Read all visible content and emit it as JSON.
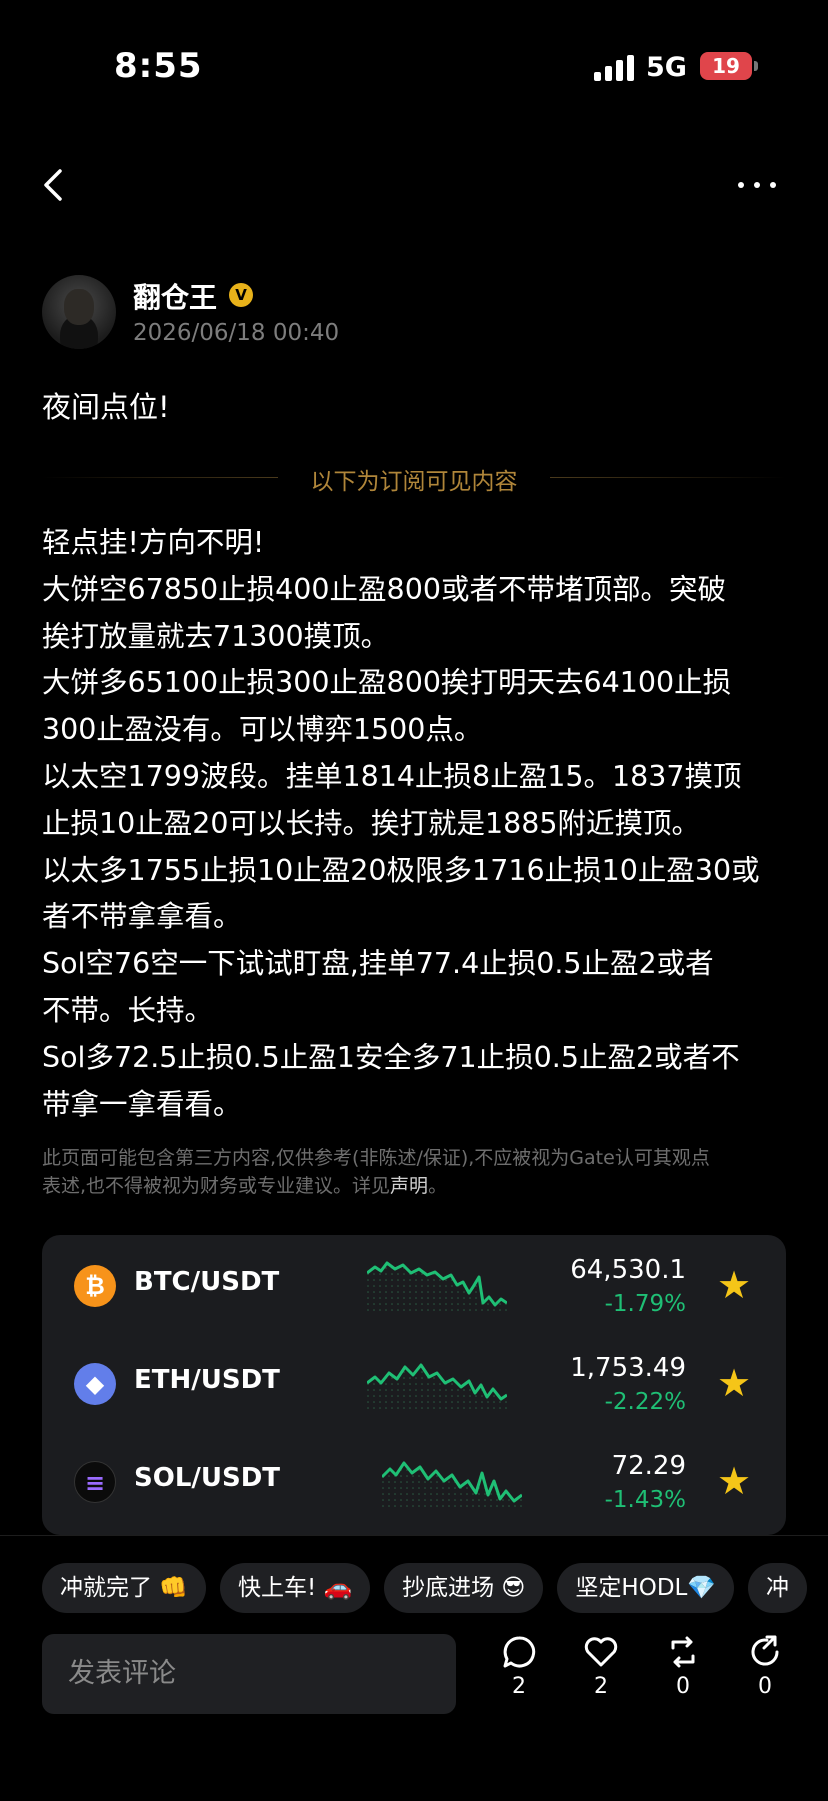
{
  "status_bar": {
    "time": "8:55",
    "network": "5G",
    "battery": "19"
  },
  "author": {
    "name": "翻仓王",
    "timestamp": "2026/06/18 00:40"
  },
  "post": {
    "intro": "夜间点位!",
    "subscribe_divider": "以下为订阅可见内容",
    "lines": [
      "轻点挂!方向不明!",
      "大饼空67850止损400止盈800或者不带堵顶部。突破",
      "挨打放量就去71300摸顶。",
      "大饼多65100止损300止盈800挨打明天去64100止损",
      "300止盈没有。可以博弈1500点。",
      "以太空1799波段。挂单1814止损8止盈15。1837摸顶",
      "止损10止盈20可以长持。挨打就是1885附近摸顶。",
      "以太多1755止损10止盈20极限多1716止损10止盈30或",
      "者不带拿拿看。",
      "Sol空76空一下试试盯盘,挂单77.4止损0.5止盈2或者",
      "不带。长持。",
      "Sol多72.5止损0.5止盈1安全多71止损0.5止盈2或者不",
      "带拿一拿看看。"
    ]
  },
  "disclaimer": {
    "line1": "此页面可能包含第三方内容,仅供参考(非陈述/保证),不应被视为Gate认可其观点",
    "line2": "表述,也不得被视为财务或专业建议。详见",
    "link": "声明",
    "end": "。"
  },
  "markets": [
    {
      "pair": "BTC/USDT",
      "price": "64,530.1",
      "change": "-1.79%",
      "icon": "bitcoin-icon",
      "glyph": "₿",
      "color": "#f7931a"
    },
    {
      "pair": "ETH/USDT",
      "price": "1,753.49",
      "change": "-2.22%",
      "icon": "ethereum-icon",
      "glyph": "◆",
      "color": "#627eea"
    },
    {
      "pair": "SOL/USDT",
      "price": "72.29",
      "change": "-1.43%",
      "icon": "solana-icon",
      "glyph": "≡",
      "color": "#0b0b0b"
    }
  ],
  "colors": {
    "down": "#1fbf75",
    "gold": "#b0863a",
    "star": "#f5c518"
  },
  "chips": [
    "冲就完了 👊",
    "快上车! 🚗",
    "抄底进场 😎",
    "坚定HODL💎",
    "冲"
  ],
  "comment": {
    "placeholder": "发表评论"
  },
  "actions": {
    "comments": "2",
    "likes": "2",
    "reposts": "0",
    "shares": "0"
  }
}
